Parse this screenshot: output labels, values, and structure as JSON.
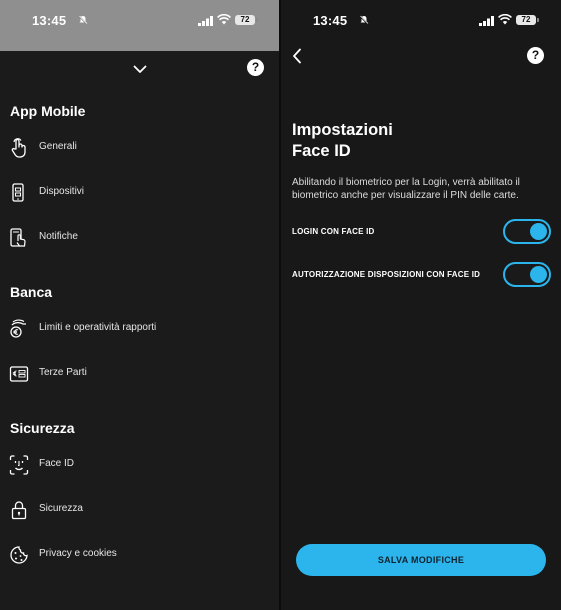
{
  "status_bar": {
    "time": "13:45",
    "battery": "72"
  },
  "left": {
    "sections": [
      {
        "title": "App Mobile",
        "items": [
          {
            "label": "Generali",
            "icon": "touch-hand-icon"
          },
          {
            "label": "Dispositivi",
            "icon": "devices-icon"
          },
          {
            "label": "Notifiche",
            "icon": "phone-touch-icon"
          }
        ]
      },
      {
        "title": "Banca",
        "items": [
          {
            "label": "Limiti e operatività rapporti",
            "icon": "euro-hand-icon"
          },
          {
            "label": "Terze Parti",
            "icon": "third-party-card-icon"
          }
        ]
      },
      {
        "title": "Sicurezza",
        "items": [
          {
            "label": "Face ID",
            "icon": "face-id-icon"
          },
          {
            "label": "Sicurezza",
            "icon": "lock-icon"
          },
          {
            "label": "Privacy e cookies",
            "icon": "cookie-icon"
          }
        ]
      }
    ]
  },
  "right": {
    "heading_line1": "Impostazioni",
    "heading_line2": "Face ID",
    "description": "Abilitando il biometrico per la Login, verrà abilitato il biometrico anche per visualizzare il PIN delle carte.",
    "toggles": [
      {
        "label": "LOGIN CON FACE ID",
        "on": true
      },
      {
        "label": "AUTORIZZAZIONE DISPOSIZIONI CON FACE ID",
        "on": true
      }
    ],
    "save_label": "SALVA MODIFICHE"
  },
  "help_label": "?",
  "colors": {
    "accent": "#2bb5ec",
    "background": "#1b1b1b",
    "status_bar_dimmed": "#8f8f8f"
  }
}
